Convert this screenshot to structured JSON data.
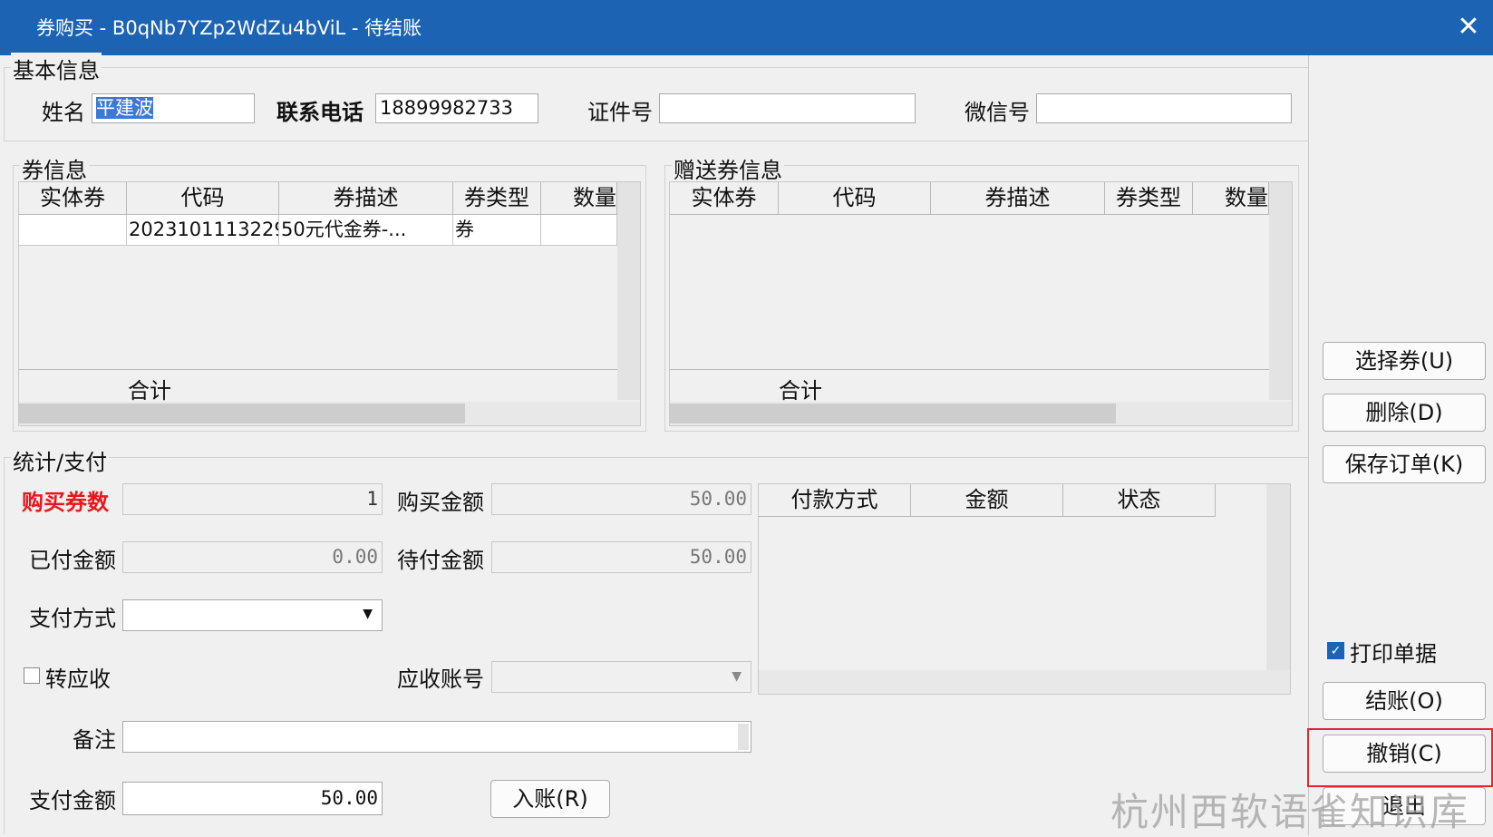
{
  "window": {
    "title": "券购买 - B0qNb7YZp2WdZu4bViL - 待结账",
    "close_glyph": "✕"
  },
  "basic": {
    "legend": "基本信息",
    "name_label": "姓名",
    "name_value": "平建波",
    "phone_label": "联系电话",
    "phone_value": "18899982733",
    "id_label": "证件号",
    "id_value": "",
    "wechat_label": "微信号",
    "wechat_value": ""
  },
  "coupon": {
    "legend": "券信息",
    "columns": [
      "实体券",
      "代码",
      "券描述",
      "券类型",
      "数量"
    ],
    "rows": [
      [
        "",
        "2023101113229",
        "50元代金券-...",
        "券",
        ""
      ]
    ],
    "total_label": "合计"
  },
  "gift": {
    "legend": "赠送券信息",
    "columns": [
      "实体券",
      "代码",
      "券描述",
      "券类型",
      "数量"
    ],
    "total_label": "合计"
  },
  "stats": {
    "legend": "统计/支付",
    "buy_count_label": "购买券数",
    "buy_count_value": "1",
    "buy_amount_label": "购买金额",
    "buy_amount_value": "50.00",
    "paid_label": "已付金额",
    "paid_value": "0.00",
    "pending_label": "待付金额",
    "pending_value": "50.00",
    "method_label": "支付方式",
    "method_value": "",
    "receivable_label": "转应收",
    "receivable_checked": false,
    "account_label": "应收账号",
    "account_value": "",
    "remark_label": "备注",
    "remark_value": "",
    "pay_amount_label": "支付金额",
    "pay_amount_value": "50.00",
    "post_button": "入账(R)",
    "payment_columns": [
      "付款方式",
      "金额",
      "状态"
    ]
  },
  "side": {
    "select_button": "选择券(U)",
    "delete_button": "删除(D)",
    "save_button": "保存订单(K)",
    "print_label": "打印单据",
    "print_checked": true,
    "checkout_button": "结账(O)",
    "cancel_button": "撤销(C)",
    "exit_button": "退出"
  },
  "watermark": "杭州西软语雀知识库",
  "colors": {
    "titlebar": "#1c64b3",
    "highlight": "#e0282a",
    "label_red": "#e8171b"
  }
}
